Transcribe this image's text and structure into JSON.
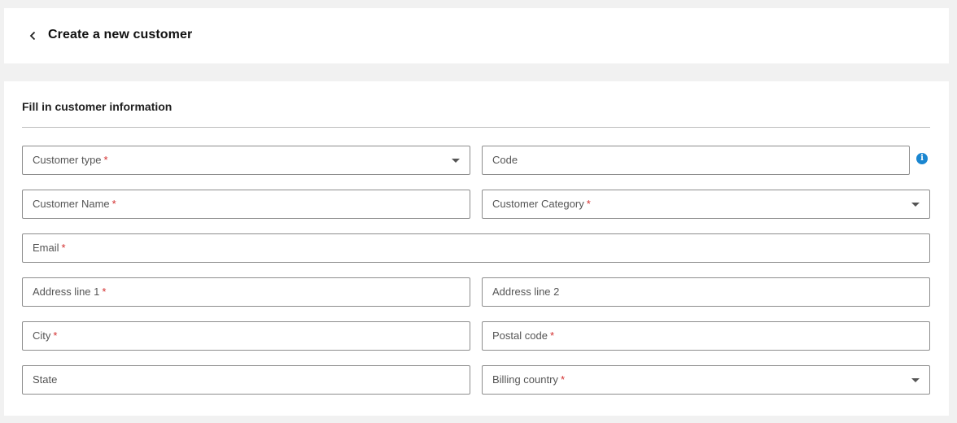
{
  "header": {
    "title": "Create a new customer",
    "back_icon": "chevron-left-icon"
  },
  "form": {
    "section_title": "Fill in customer information",
    "required_marker": "*",
    "fields": {
      "customer_type": {
        "label": "Customer type",
        "required": true,
        "type": "select",
        "value": ""
      },
      "code": {
        "label": "Code",
        "required": false,
        "type": "text",
        "value": ""
      },
      "customer_name": {
        "label": "Customer Name",
        "required": true,
        "type": "text",
        "value": ""
      },
      "customer_category": {
        "label": "Customer Category",
        "required": true,
        "type": "select",
        "value": ""
      },
      "email": {
        "label": "Email",
        "required": true,
        "type": "text",
        "value": ""
      },
      "address_line_1": {
        "label": "Address line 1",
        "required": true,
        "type": "text",
        "value": ""
      },
      "address_line_2": {
        "label": "Address line 2",
        "required": false,
        "type": "text",
        "value": ""
      },
      "city": {
        "label": "City",
        "required": true,
        "type": "text",
        "value": ""
      },
      "postal_code": {
        "label": "Postal code",
        "required": true,
        "type": "text",
        "value": ""
      },
      "state": {
        "label": "State",
        "required": false,
        "type": "text",
        "value": ""
      },
      "billing_country": {
        "label": "Billing country",
        "required": true,
        "type": "select",
        "value": ""
      }
    },
    "info_icon": {
      "icon": "info-icon",
      "glyph": "i",
      "color": "#1a86d0"
    }
  },
  "colors": {
    "page_background": "#f1f1f1",
    "card_background": "#ffffff",
    "required_marker": "#d32f2f",
    "info_accent": "#1a86d0"
  }
}
